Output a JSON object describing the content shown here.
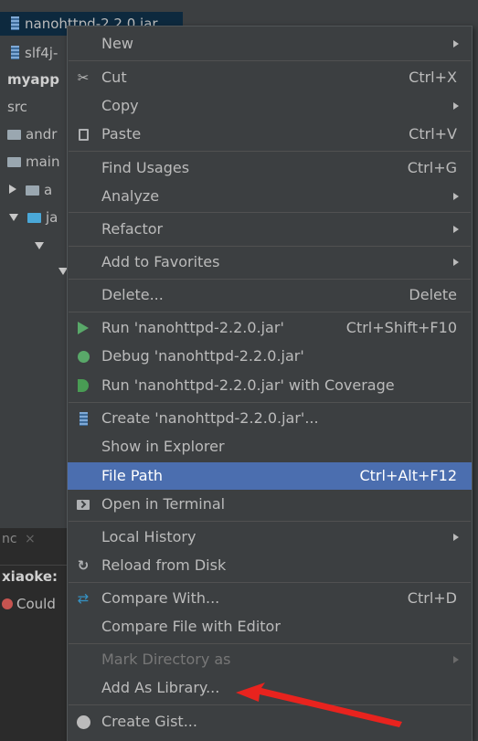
{
  "tree": {
    "rows": [
      {
        "text": "nanohttpd-2.2.0.jar",
        "icon": "jar-icon",
        "selected": true
      },
      {
        "text": "slf4j-",
        "icon": "jar-icon"
      },
      {
        "text": "myapp",
        "bold": true
      },
      {
        "text": "src"
      },
      {
        "text": "andr",
        "icon": "folder-icon"
      },
      {
        "text": "main",
        "icon": "folder-icon"
      },
      {
        "text": "a",
        "icon": "folder-icon",
        "expander": "collapsed"
      },
      {
        "text": "ja",
        "icon": "folder-blue-icon",
        "expander": "expanded"
      }
    ]
  },
  "bottom_panel": {
    "tab_label": "nc",
    "tab_close": "×",
    "run_label": "xiaoke:",
    "error_text": "Could"
  },
  "menu": {
    "new": {
      "label": "New"
    },
    "cut": {
      "label": "Cut",
      "shortcut": "Ctrl+X"
    },
    "copy": {
      "label": "Copy"
    },
    "paste": {
      "label": "Paste",
      "shortcut": "Ctrl+V"
    },
    "find_usages": {
      "label": "Find Usages",
      "shortcut": "Ctrl+G"
    },
    "analyze": {
      "label": "Analyze"
    },
    "refactor": {
      "label": "Refactor"
    },
    "add_to_favorites": {
      "label": "Add to Favorites"
    },
    "delete": {
      "label": "Delete...",
      "shortcut": "Delete"
    },
    "run": {
      "label": "Run 'nanohttpd-2.2.0.jar'",
      "shortcut": "Ctrl+Shift+F10"
    },
    "debug": {
      "label": "Debug 'nanohttpd-2.2.0.jar'"
    },
    "run_coverage": {
      "label": "Run 'nanohttpd-2.2.0.jar' with Coverage"
    },
    "create": {
      "label": "Create 'nanohttpd-2.2.0.jar'..."
    },
    "show_in_explorer": {
      "label": "Show in Explorer"
    },
    "file_path": {
      "label": "File Path",
      "shortcut": "Ctrl+Alt+F12"
    },
    "open_in_terminal": {
      "label": "Open in Terminal"
    },
    "local_history": {
      "label": "Local History"
    },
    "reload_from_disk": {
      "label": "Reload from Disk"
    },
    "compare_with": {
      "label": "Compare With...",
      "shortcut": "Ctrl+D"
    },
    "compare_file_with_editor": {
      "label": "Compare File with Editor"
    },
    "mark_directory_as": {
      "label": "Mark Directory as"
    },
    "add_as_library": {
      "label": "Add As Library..."
    },
    "create_gist": {
      "label": "Create Gist..."
    }
  },
  "colors": {
    "menu_bg": "#3c3f41",
    "selection": "#4b6eaf",
    "annotation_arrow": "#e8231e"
  }
}
